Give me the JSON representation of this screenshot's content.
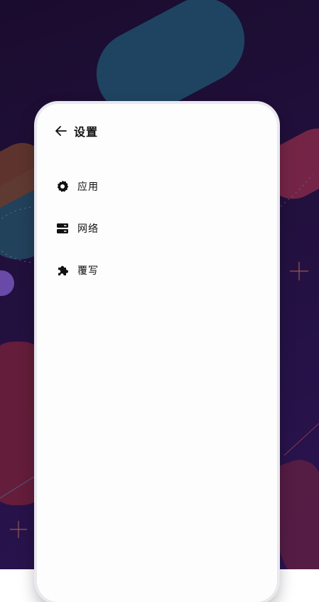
{
  "header": {
    "title": "设置",
    "back_icon": "arrow-left-icon"
  },
  "menu": {
    "items": [
      {
        "label": "应用",
        "icon": "gear-icon"
      },
      {
        "label": "网络",
        "icon": "server-icon"
      },
      {
        "label": "覆写",
        "icon": "puzzle-icon"
      }
    ]
  },
  "colors": {
    "background": "#22103e",
    "panel": "#fdfdfe",
    "text": "#111111"
  }
}
